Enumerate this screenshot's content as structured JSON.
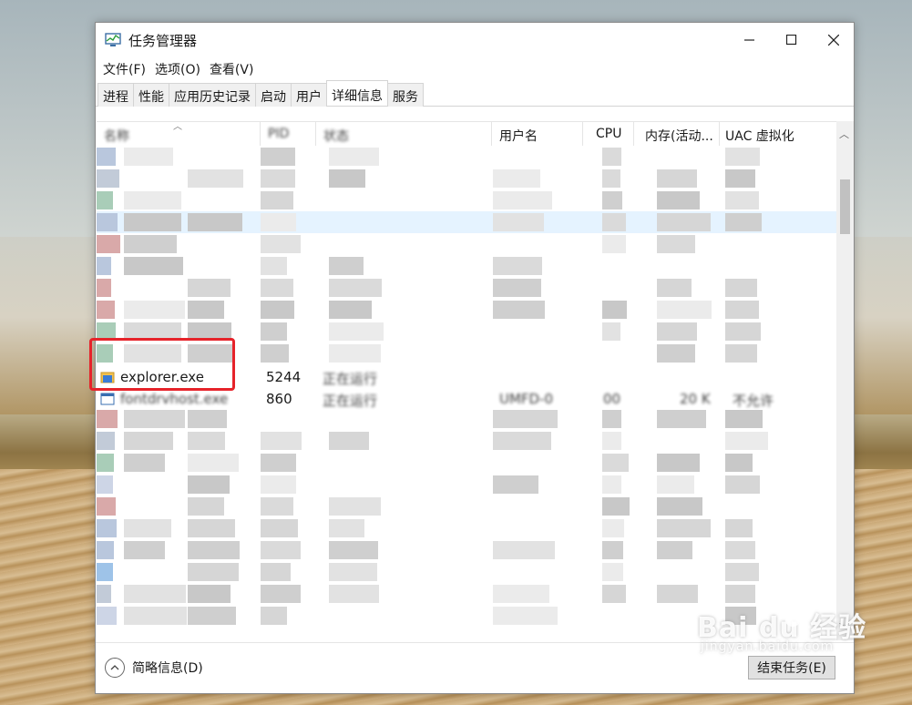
{
  "window": {
    "title": "任务管理器",
    "controls": {
      "minimize": "—",
      "maximize": "☐",
      "close": "✕"
    }
  },
  "menu": [
    "文件(F)",
    "选项(O)",
    "查看(V)"
  ],
  "tabs": [
    "进程",
    "性能",
    "应用历史记录",
    "启动",
    "用户",
    "详细信息",
    "服务"
  ],
  "active_tab": "详细信息",
  "columns": {
    "name": "名称",
    "pid": "PID",
    "status": "状态",
    "username": "用户名",
    "cpu": "CPU",
    "memory": "内存(活动...",
    "uac": "UAC 虚拟化"
  },
  "rows": {
    "explorer": {
      "name": "explorer.exe",
      "pid": "5244",
      "status": "正在运行"
    },
    "fontdrvhost": {
      "name": "fontdrvhost.exe",
      "pid": "860",
      "status": "正在运行",
      "username": "UMFD-0",
      "cpu": "00",
      "memory": "20 K",
      "uac": "不允许"
    }
  },
  "footer": {
    "less_details": "简略信息(D)",
    "end_task": "结束任务(E)"
  },
  "watermark": {
    "main": "Bai du 经验",
    "sub": "jingyan.baidu.com"
  },
  "colors": {
    "highlight": "#e6232a",
    "selection": "#e5f3ff"
  }
}
